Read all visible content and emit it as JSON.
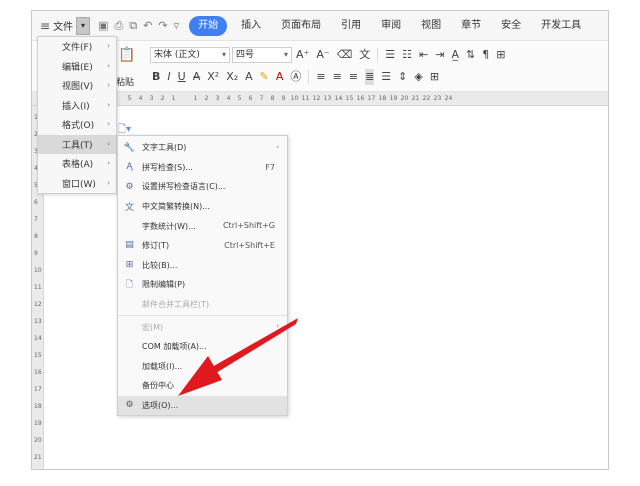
{
  "menubar": {
    "file_label": "文件",
    "tabs": [
      "开始",
      "插入",
      "页面布局",
      "引用",
      "审阅",
      "视图",
      "章节",
      "安全",
      "开发工具"
    ]
  },
  "ribbon": {
    "paste_label": "粘贴",
    "font_name": "宋体 (正文)",
    "font_size": "四号"
  },
  "ruler": {
    "h_ticks": [
      "5",
      "4",
      "3",
      "2",
      "1",
      "",
      "1",
      "2",
      "3",
      "4",
      "5",
      "6",
      "7",
      "8",
      "9",
      "10",
      "11",
      "12",
      "13",
      "14",
      "15",
      "16",
      "17",
      "18",
      "19",
      "20",
      "21",
      "22",
      "23",
      "24"
    ],
    "v_ticks": [
      "1",
      "2",
      "3",
      "4",
      "5",
      "6",
      "7",
      "8",
      "9",
      "10",
      "11",
      "12",
      "13",
      "14",
      "15",
      "16",
      "17",
      "18",
      "19",
      "20",
      "21"
    ]
  },
  "main_menu": {
    "items": [
      {
        "label": "文件(F)"
      },
      {
        "label": "编辑(E)"
      },
      {
        "label": "视图(V)"
      },
      {
        "label": "插入(I)"
      },
      {
        "label": "格式(O)"
      },
      {
        "label": "工具(T)"
      },
      {
        "label": "表格(A)"
      },
      {
        "label": "窗口(W)"
      }
    ]
  },
  "tools_menu": {
    "items": [
      {
        "label": "文字工具(D)",
        "shortcut": "",
        "icon": "wrench-icon"
      },
      {
        "label": "拼写检查(S)...",
        "shortcut": "F7",
        "icon": "spellcheck-icon"
      },
      {
        "label": "设置拼写检查语言(C)...",
        "shortcut": "",
        "icon": "language-icon"
      },
      {
        "label": "中文简繁转换(N)...",
        "shortcut": "",
        "icon": "convert-icon"
      },
      {
        "label": "字数统计(W)...",
        "shortcut": "Ctrl+Shift+G",
        "icon": ""
      },
      {
        "label": "修订(T)",
        "shortcut": "Ctrl+Shift+E",
        "icon": "revision-icon"
      },
      {
        "label": "比较(B)...",
        "shortcut": "",
        "icon": "compare-icon"
      },
      {
        "label": "限制编辑(P)",
        "shortcut": "",
        "icon": "restrict-icon"
      },
      {
        "label": "邮件合并工具栏(T)",
        "shortcut": "",
        "icon": ""
      },
      {
        "label": "宏(M)",
        "shortcut": "",
        "icon": ""
      },
      {
        "label": "COM 加载项(A)...",
        "shortcut": "",
        "icon": ""
      },
      {
        "label": "加载项(I)...",
        "shortcut": "",
        "icon": ""
      },
      {
        "label": "备份中心",
        "shortcut": "",
        "icon": ""
      },
      {
        "label": "选项(O)...",
        "shortcut": "",
        "icon": "gear-icon"
      }
    ]
  },
  "colors": {
    "accent": "#3f7ff2",
    "arrow": "#e0191f"
  }
}
